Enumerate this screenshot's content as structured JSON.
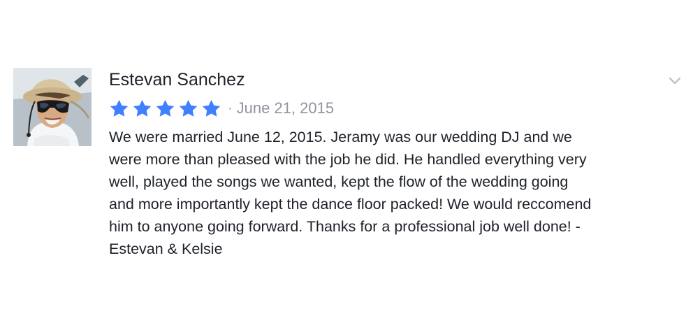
{
  "review": {
    "reviewer_name": "Estevan Sanchez",
    "rating": 5,
    "max_rating": 5,
    "separator": "·",
    "date": "June 21, 2015",
    "text": "We were married June 12, 2015. Jeramy was our wedding DJ and we\nwere more than pleased with the job he did. He handled everything very\nwell, played the songs we wanted, kept the flow of the wedding going\nand more importantly kept the dance floor packed! We would reccomend\nhim to anyone going forward. Thanks for a professional job well done! -\nEstevan & Kelsie"
  },
  "icons": {
    "star": "star-icon",
    "menu": "chevron-down-icon"
  },
  "colors": {
    "star": "#4080ff",
    "date": "#90949c",
    "text": "#1d2129",
    "chevron": "#bec2c9"
  }
}
